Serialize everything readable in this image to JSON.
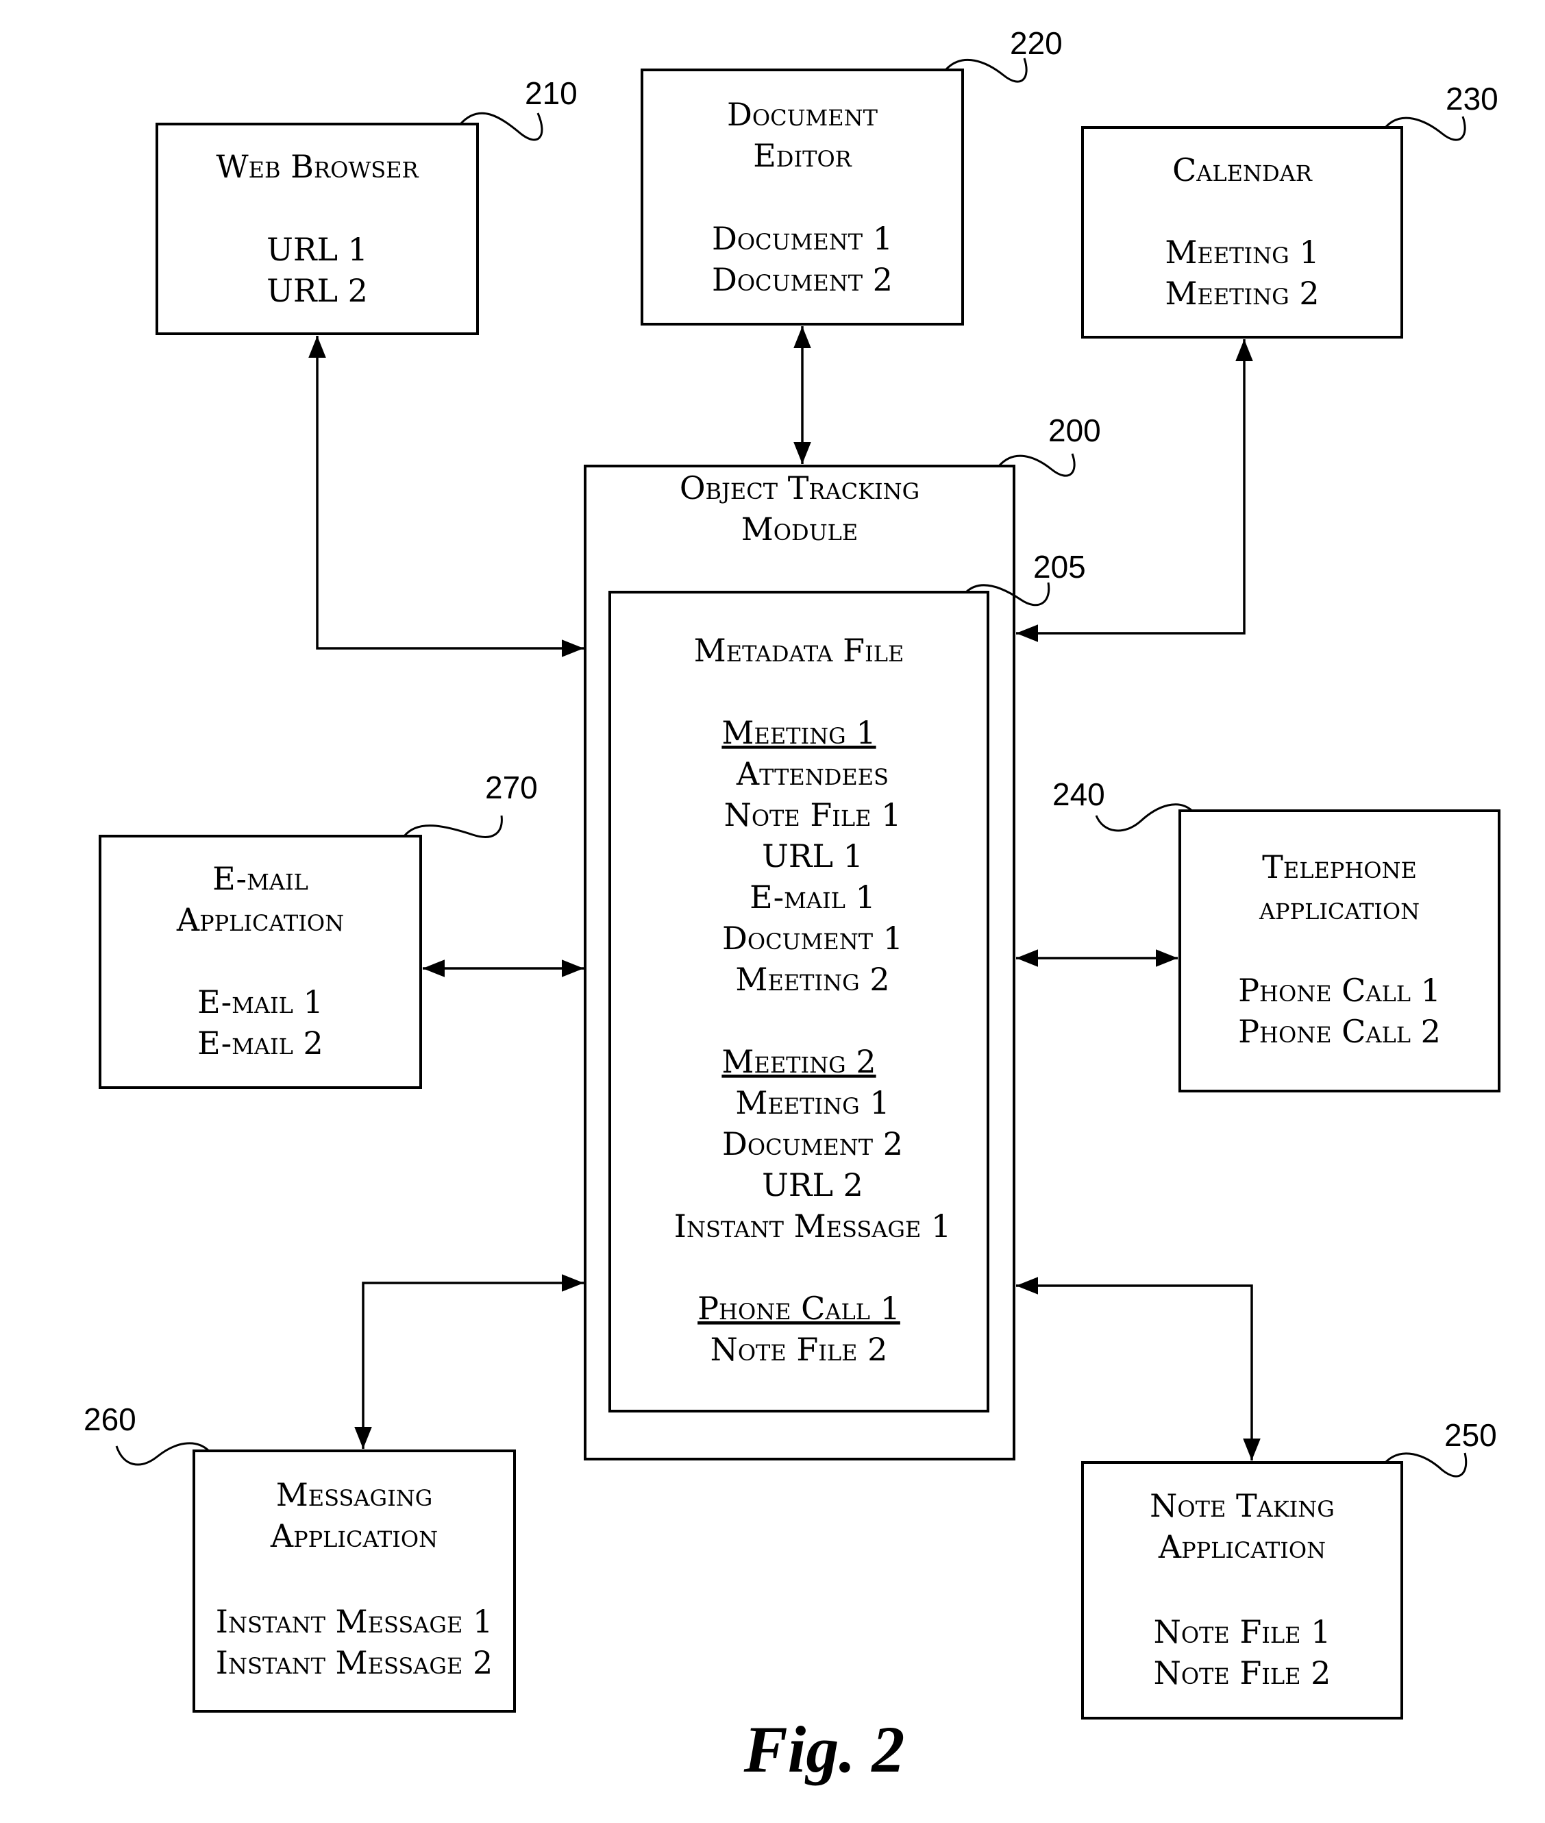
{
  "figure_label": "Fig. 2",
  "modules": {
    "web_browser": {
      "ref": "210",
      "title": [
        "Web Browser"
      ],
      "items": [
        "URL 1",
        "URL 2"
      ]
    },
    "document_editor": {
      "ref": "220",
      "title": [
        "Document",
        "Editor"
      ],
      "items": [
        "Document 1",
        "Document 2"
      ]
    },
    "calendar": {
      "ref": "230",
      "title": [
        "Calendar"
      ],
      "items": [
        "Meeting 1",
        "Meeting 2"
      ]
    },
    "telephone": {
      "ref": "240",
      "title": [
        "Telephone",
        "application"
      ],
      "items": [
        "Phone Call 1",
        "Phone Call 2"
      ]
    },
    "note_taking": {
      "ref": "250",
      "title": [
        "Note Taking",
        "Application"
      ],
      "items": [
        "Note File 1",
        "Note File 2"
      ]
    },
    "messaging": {
      "ref": "260",
      "title": [
        "Messaging",
        "Application"
      ],
      "items": [
        "Instant Message 1",
        "Instant Message 2"
      ]
    },
    "email": {
      "ref": "270",
      "title": [
        "E-mail",
        "Application"
      ],
      "items": [
        "E-mail 1",
        "E-mail 2"
      ]
    }
  },
  "object_tracking_module": {
    "ref": "200",
    "title": [
      "Object Tracking",
      "Module"
    ],
    "metadata_file": {
      "ref": "205",
      "title": "Metadata File",
      "groups": [
        {
          "heading": "Meeting 1",
          "items": [
            "Attendees",
            "Note File 1",
            "URL 1",
            "E-mail 1",
            "Document 1",
            "Meeting 2"
          ]
        },
        {
          "heading": "Meeting 2",
          "items": [
            "Meeting 1",
            "Document 2",
            "URL 2",
            "Instant Message 1"
          ]
        },
        {
          "heading": "Phone Call 1",
          "items": [
            "Note File 2"
          ]
        }
      ]
    }
  },
  "connections": [
    {
      "from": "web_browser",
      "to": "object_tracking_module",
      "direction": "bidirectional"
    },
    {
      "from": "document_editor",
      "to": "object_tracking_module",
      "direction": "bidirectional"
    },
    {
      "from": "calendar",
      "to": "object_tracking_module",
      "direction": "bidirectional"
    },
    {
      "from": "email",
      "to": "object_tracking_module",
      "direction": "bidirectional"
    },
    {
      "from": "telephone",
      "to": "object_tracking_module",
      "direction": "bidirectional"
    },
    {
      "from": "messaging",
      "to": "object_tracking_module",
      "direction": "bidirectional"
    },
    {
      "from": "note_taking",
      "to": "object_tracking_module",
      "direction": "bidirectional"
    }
  ]
}
